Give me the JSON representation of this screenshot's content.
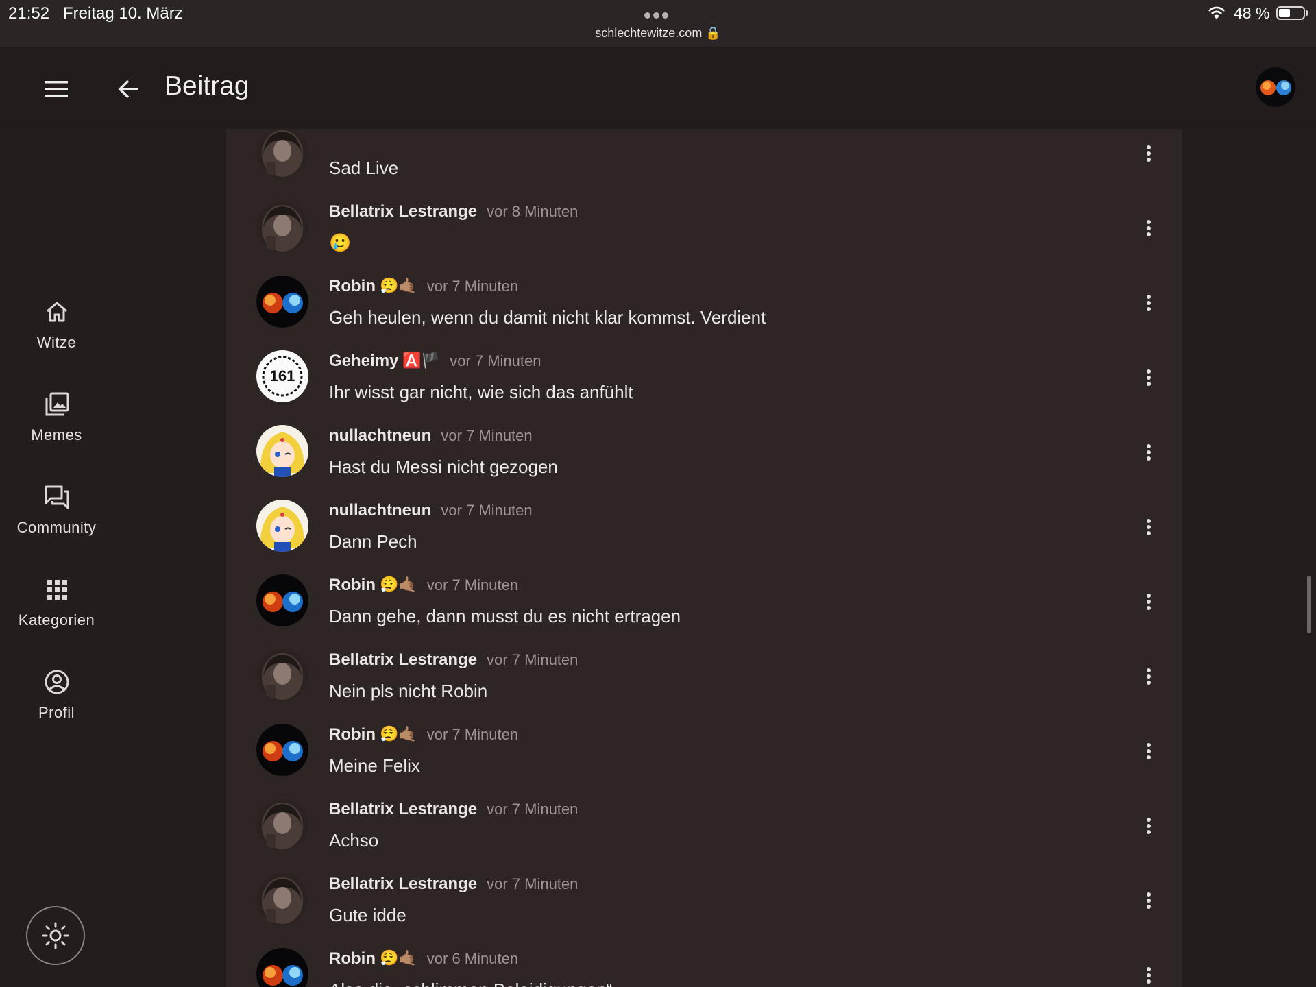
{
  "status_bar": {
    "time": "21:52",
    "date": "Freitag 10. März",
    "url": "schlechtewitze.com 🔒",
    "battery": "48 %",
    "battery_level": 0.48
  },
  "app_bar": {
    "title": "Beitrag",
    "menu_icon": "hamburger-menu-icon",
    "back_icon": "arrow-left-icon"
  },
  "nav": {
    "items": [
      {
        "label": "Witze",
        "icon": "home-icon"
      },
      {
        "label": "Memes",
        "icon": "image-gallery-icon"
      },
      {
        "label": "Community",
        "icon": "forum-icon"
      },
      {
        "label": "Kategorien",
        "icon": "grid-icon"
      },
      {
        "label": "Profil",
        "icon": "account-circle-icon"
      }
    ],
    "theme_icon": "sun-icon"
  },
  "comments": [
    {
      "author": "",
      "time": "",
      "text": "Sad Live",
      "emoji": "",
      "avatar": "bellatrix"
    },
    {
      "author": "Bellatrix Lestrange",
      "time": "vor 8 Minuten",
      "text": "🥲",
      "emoji": "",
      "avatar": "bellatrix"
    },
    {
      "author": "Robin",
      "time": "vor 7 Minuten",
      "text": "Geh heulen, wenn du damit nicht klar kommst. Verdient",
      "emoji": "😮‍💨🤙🏽",
      "avatar": "robin"
    },
    {
      "author": "Geheimy",
      "time": "vor 7 Minuten",
      "text": "Ihr wisst gar nicht, wie sich das anfühlt",
      "emoji": "🅰️🏴",
      "avatar": "geheimy"
    },
    {
      "author": "nullachtneun",
      "time": "vor 7 Minuten",
      "text": "Hast du Messi nicht gezogen",
      "emoji": "",
      "avatar": "sailor"
    },
    {
      "author": "nullachtneun",
      "time": "vor 7 Minuten",
      "text": "Dann Pech",
      "emoji": "",
      "avatar": "sailor"
    },
    {
      "author": "Robin",
      "time": "vor 7 Minuten",
      "text": "Dann gehe, dann musst du es nicht ertragen",
      "emoji": "😮‍💨🤙🏽",
      "avatar": "robin"
    },
    {
      "author": "Bellatrix Lestrange",
      "time": "vor 7 Minuten",
      "text": "Nein pls nicht Robin",
      "emoji": "",
      "avatar": "bellatrix"
    },
    {
      "author": "Robin",
      "time": "vor 7 Minuten",
      "text": "Meine Felix",
      "emoji": "😮‍💨🤙🏽",
      "avatar": "robin"
    },
    {
      "author": "Bellatrix Lestrange",
      "time": "vor 7 Minuten",
      "text": "Achso",
      "emoji": "",
      "avatar": "bellatrix"
    },
    {
      "author": "Bellatrix Lestrange",
      "time": "vor 7 Minuten",
      "text": "Gute idde",
      "emoji": "",
      "avatar": "bellatrix"
    },
    {
      "author": "Robin",
      "time": "vor 6 Minuten",
      "text": "Also die „schlimmen Beleidigungen“",
      "emoji": "😮‍💨🤙🏽",
      "avatar": "robin"
    }
  ],
  "geheimy_badge": "161",
  "colors": {
    "background": "#231d1c",
    "content": "#2e2624",
    "text": "#ece7e4",
    "muted": "#9d9592"
  }
}
